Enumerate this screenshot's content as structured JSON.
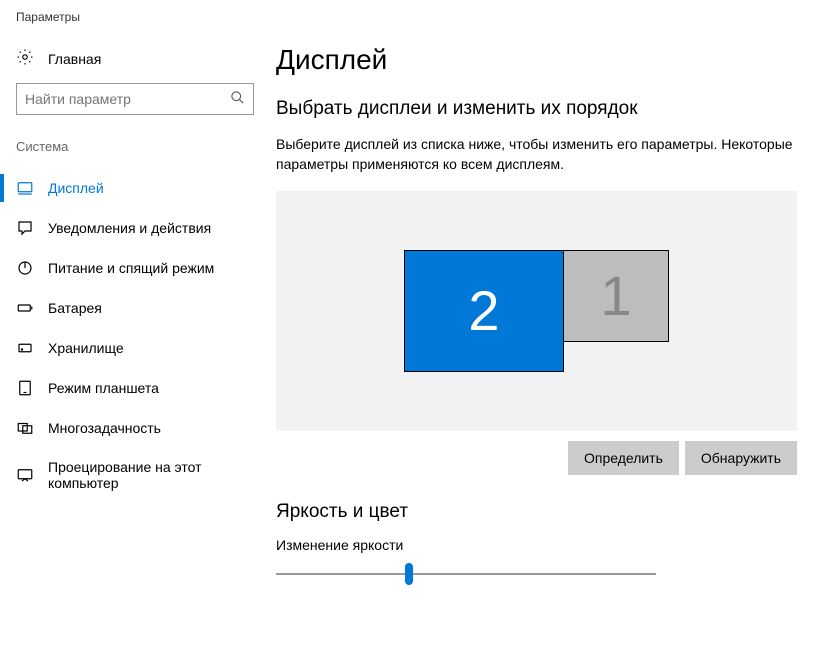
{
  "window": {
    "title": "Параметры"
  },
  "sidebar": {
    "home": "Главная",
    "search_placeholder": "Найти параметр",
    "section": "Система",
    "items": [
      {
        "label": "Дисплей"
      },
      {
        "label": "Уведомления и действия"
      },
      {
        "label": "Питание и спящий режим"
      },
      {
        "label": "Батарея"
      },
      {
        "label": "Хранилище"
      },
      {
        "label": "Режим планшета"
      },
      {
        "label": "Многозадачность"
      },
      {
        "label": "Проецирование на этот компьютер"
      }
    ]
  },
  "main": {
    "title": "Дисплей",
    "arrange_title": "Выбрать дисплеи и изменить их порядок",
    "arrange_desc": "Выберите дисплей из списка ниже, чтобы изменить его параметры. Некоторые параметры применяются ко всем дисплеям.",
    "monitors": {
      "primary": "2",
      "secondary": "1"
    },
    "identify_btn": "Определить",
    "detect_btn": "Обнаружить",
    "brightness_title": "Яркость и цвет",
    "brightness_label": "Изменение яркости"
  }
}
